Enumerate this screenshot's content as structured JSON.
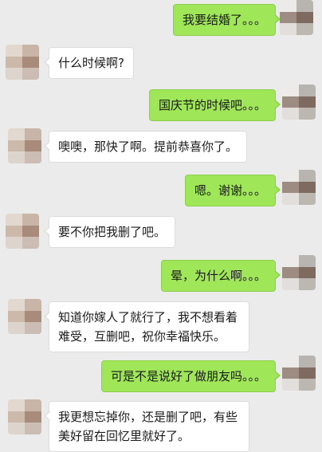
{
  "theme": {
    "background": "#ebebeb",
    "outgoing_bubble": "#9fe659",
    "incoming_bubble": "#ffffff"
  },
  "messages": [
    {
      "from": "me",
      "text": "我要结婚了。。。"
    },
    {
      "from": "friend",
      "text": "什么时候啊?"
    },
    {
      "from": "me",
      "text": "国庆节的时候吧。。。"
    },
    {
      "from": "friend",
      "text": "噢噢，那快了啊。提前恭喜你了。"
    },
    {
      "from": "me",
      "text": "嗯。谢谢。。。"
    },
    {
      "from": "friend",
      "text": "要不你把我删了吧。"
    },
    {
      "from": "me",
      "text": "晕，为什么啊。。。"
    },
    {
      "from": "friend",
      "lines": [
        "知道你嫁人了就行了，我不想看着",
        "难受，互删吧，祝你幸福快乐。"
      ]
    },
    {
      "from": "me",
      "text": "可是不是说好了做朋友吗。。。"
    },
    {
      "from": "friend",
      "lines": [
        "我更想忘掉你，还是删了吧，有些",
        "美好留在回忆里就好了。"
      ]
    }
  ]
}
